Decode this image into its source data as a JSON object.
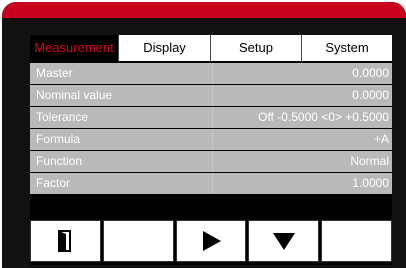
{
  "tabs": [
    {
      "label": "Measurement",
      "active": true
    },
    {
      "label": "Display",
      "active": false
    },
    {
      "label": "Setup",
      "active": false
    },
    {
      "label": "System",
      "active": false
    }
  ],
  "rows": [
    {
      "label": "Master",
      "value": "0.0000"
    },
    {
      "label": "Nominal value",
      "value": "0.0000"
    },
    {
      "label": "Tolerance",
      "value": "Off -0.5000 <0> +0.5000"
    },
    {
      "label": "Formula",
      "value": "+A"
    },
    {
      "label": "Function",
      "value": "Normal"
    },
    {
      "label": "Factor",
      "value": "1.0000"
    }
  ],
  "softkeys": [
    {
      "icon": "exit-door-icon"
    },
    {
      "icon": ""
    },
    {
      "icon": "play-triangle-icon"
    },
    {
      "icon": "down-triangle-icon"
    },
    {
      "icon": ""
    }
  ],
  "colors": {
    "accent": "#d7001a",
    "row_bg": "#b9b9b9",
    "frame": "#111111"
  }
}
